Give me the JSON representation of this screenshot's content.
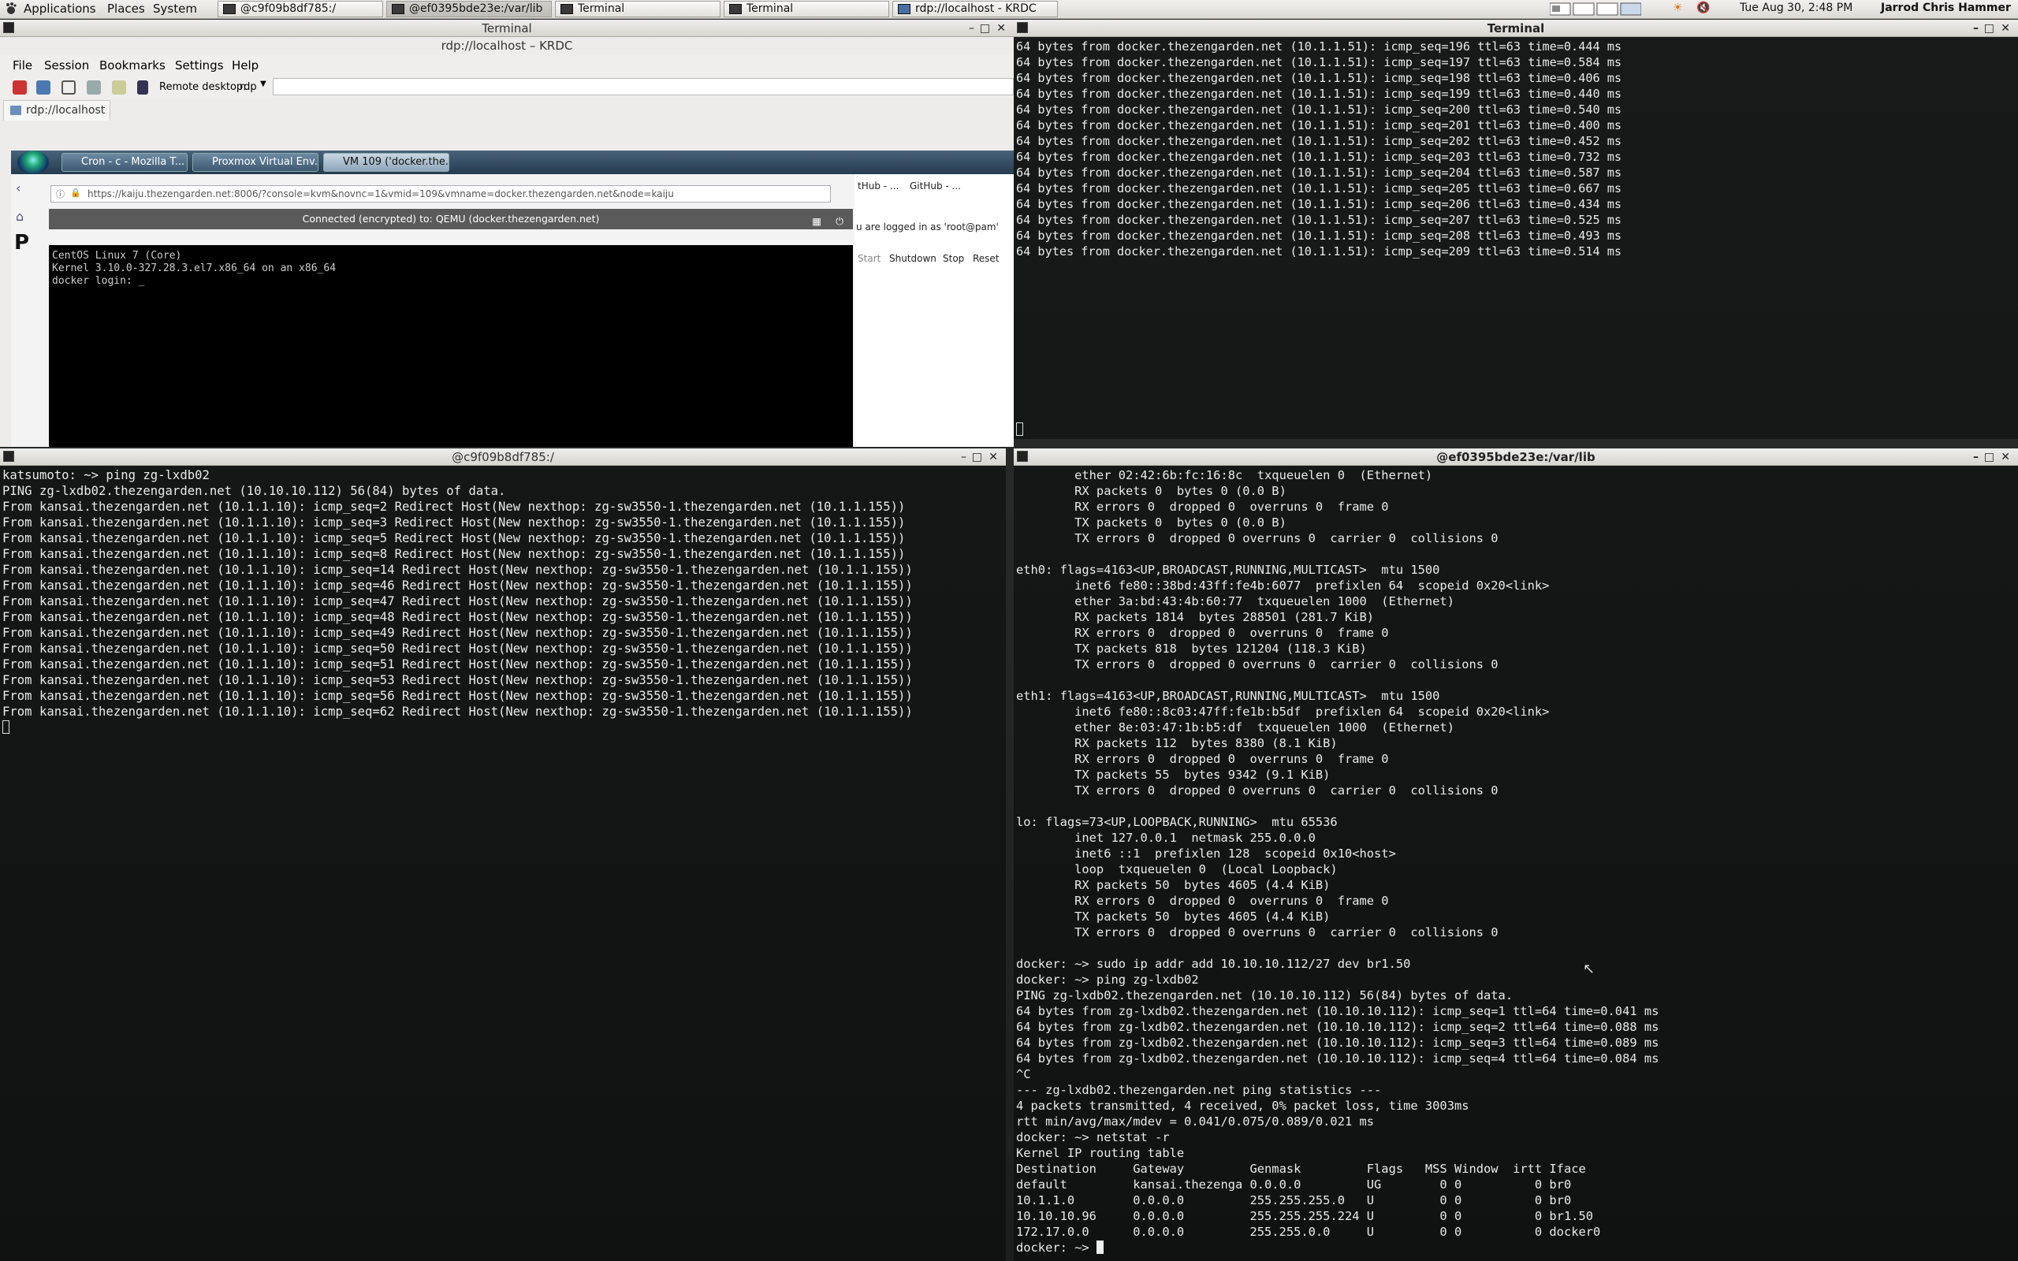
{
  "panel": {
    "menus": [
      "Applications",
      "Places",
      "System"
    ],
    "tasks": [
      {
        "label": "@c9f09b8df785:/",
        "active": false
      },
      {
        "label": "@ef0395bde23e:/var/lib",
        "active": true
      },
      {
        "label": "Terminal",
        "active": false
      },
      {
        "label": "Terminal",
        "active": false
      },
      {
        "label": "rdp://localhost - KRDC",
        "active": false
      }
    ],
    "clock": "Tue Aug 30,  2:48 PM",
    "user": "Jarrod Chris Hammer"
  },
  "krdc": {
    "window_title": "Terminal",
    "title": "rdp://localhost – KRDC",
    "menu": [
      "File",
      "Session",
      "Bookmarks",
      "Settings",
      "Help"
    ],
    "remote_desktop_label": "Remote desktop:",
    "protocol": "rdp",
    "tab": "rdp://localhost",
    "win7_tabs": [
      "Cron - c - Mozilla T...",
      "Proxmox Virtual Env...",
      "VM 109 ('docker.the..."
    ],
    "url": "https://kaiju.thezengarden.net:8006/?console=kvm&novnc=1&vmid=109&vmname=docker.thezengarden.net&node=kaiju",
    "novnc_status": "Connected (encrypted) to: QEMU (docker.thezengarden.net)",
    "console_lines": [
      "CentOS Linux 7 (Core)",
      "Kernel 3.10.0-327.28.3.el7.x86_64 on an x86_64",
      "",
      "docker login: _"
    ],
    "proxmox_tabs": [
      "tHub - ...",
      "GitHub - ..."
    ],
    "proxmox_login": "u are logged in as 'root@pam'",
    "proxmox_actions": [
      "Start",
      "Shutdown",
      "Stop",
      "Reset"
    ]
  },
  "term_top_right": {
    "title": "Terminal",
    "lines": [
      "64 bytes from docker.thezengarden.net (10.1.1.51): icmp_seq=196 ttl=63 time=0.444 ms",
      "64 bytes from docker.thezengarden.net (10.1.1.51): icmp_seq=197 ttl=63 time=0.584 ms",
      "64 bytes from docker.thezengarden.net (10.1.1.51): icmp_seq=198 ttl=63 time=0.406 ms",
      "64 bytes from docker.thezengarden.net (10.1.1.51): icmp_seq=199 ttl=63 time=0.440 ms",
      "64 bytes from docker.thezengarden.net (10.1.1.51): icmp_seq=200 ttl=63 time=0.540 ms",
      "64 bytes from docker.thezengarden.net (10.1.1.51): icmp_seq=201 ttl=63 time=0.400 ms",
      "64 bytes from docker.thezengarden.net (10.1.1.51): icmp_seq=202 ttl=63 time=0.452 ms",
      "64 bytes from docker.thezengarden.net (10.1.1.51): icmp_seq=203 ttl=63 time=0.732 ms",
      "64 bytes from docker.thezengarden.net (10.1.1.51): icmp_seq=204 ttl=63 time=0.587 ms",
      "64 bytes from docker.thezengarden.net (10.1.1.51): icmp_seq=205 ttl=63 time=0.667 ms",
      "64 bytes from docker.thezengarden.net (10.1.1.51): icmp_seq=206 ttl=63 time=0.434 ms",
      "64 bytes from docker.thezengarden.net (10.1.1.51): icmp_seq=207 ttl=63 time=0.525 ms",
      "64 bytes from docker.thezengarden.net (10.1.1.51): icmp_seq=208 ttl=63 time=0.493 ms",
      "64 bytes from docker.thezengarden.net (10.1.1.51): icmp_seq=209 ttl=63 time=0.514 ms"
    ]
  },
  "term_bottom_left": {
    "title": "@c9f09b8df785:/",
    "lines": [
      "katsumoto: ~> ping zg-lxdb02",
      "PING zg-lxdb02.thezengarden.net (10.10.10.112) 56(84) bytes of data.",
      "From kansai.thezengarden.net (10.1.1.10): icmp_seq=2 Redirect Host(New nexthop: zg-sw3550-1.thezengarden.net (10.1.1.155))",
      "From kansai.thezengarden.net (10.1.1.10): icmp_seq=3 Redirect Host(New nexthop: zg-sw3550-1.thezengarden.net (10.1.1.155))",
      "From kansai.thezengarden.net (10.1.1.10): icmp_seq=5 Redirect Host(New nexthop: zg-sw3550-1.thezengarden.net (10.1.1.155))",
      "From kansai.thezengarden.net (10.1.1.10): icmp_seq=8 Redirect Host(New nexthop: zg-sw3550-1.thezengarden.net (10.1.1.155))",
      "From kansai.thezengarden.net (10.1.1.10): icmp_seq=14 Redirect Host(New nexthop: zg-sw3550-1.thezengarden.net (10.1.1.155))",
      "From kansai.thezengarden.net (10.1.1.10): icmp_seq=46 Redirect Host(New nexthop: zg-sw3550-1.thezengarden.net (10.1.1.155))",
      "From kansai.thezengarden.net (10.1.1.10): icmp_seq=47 Redirect Host(New nexthop: zg-sw3550-1.thezengarden.net (10.1.1.155))",
      "From kansai.thezengarden.net (10.1.1.10): icmp_seq=48 Redirect Host(New nexthop: zg-sw3550-1.thezengarden.net (10.1.1.155))",
      "From kansai.thezengarden.net (10.1.1.10): icmp_seq=49 Redirect Host(New nexthop: zg-sw3550-1.thezengarden.net (10.1.1.155))",
      "From kansai.thezengarden.net (10.1.1.10): icmp_seq=50 Redirect Host(New nexthop: zg-sw3550-1.thezengarden.net (10.1.1.155))",
      "From kansai.thezengarden.net (10.1.1.10): icmp_seq=51 Redirect Host(New nexthop: zg-sw3550-1.thezengarden.net (10.1.1.155))",
      "From kansai.thezengarden.net (10.1.1.10): icmp_seq=53 Redirect Host(New nexthop: zg-sw3550-1.thezengarden.net (10.1.1.155))",
      "From kansai.thezengarden.net (10.1.1.10): icmp_seq=56 Redirect Host(New nexthop: zg-sw3550-1.thezengarden.net (10.1.1.155))",
      "From kansai.thezengarden.net (10.1.1.10): icmp_seq=62 Redirect Host(New nexthop: zg-sw3550-1.thezengarden.net (10.1.1.155))"
    ]
  },
  "term_bottom_right": {
    "title": "@ef0395bde23e:/var/lib",
    "lines": [
      "        ether 02:42:6b:fc:16:8c  txqueuelen 0  (Ethernet)",
      "        RX packets 0  bytes 0 (0.0 B)",
      "        RX errors 0  dropped 0  overruns 0  frame 0",
      "        TX packets 0  bytes 0 (0.0 B)",
      "        TX errors 0  dropped 0 overruns 0  carrier 0  collisions 0",
      "",
      "eth0: flags=4163<UP,BROADCAST,RUNNING,MULTICAST>  mtu 1500",
      "        inet6 fe80::38bd:43ff:fe4b:6077  prefixlen 64  scopeid 0x20<link>",
      "        ether 3a:bd:43:4b:60:77  txqueuelen 1000  (Ethernet)",
      "        RX packets 1814  bytes 288501 (281.7 KiB)",
      "        RX errors 0  dropped 0  overruns 0  frame 0",
      "        TX packets 818  bytes 121204 (118.3 KiB)",
      "        TX errors 0  dropped 0 overruns 0  carrier 0  collisions 0",
      "",
      "eth1: flags=4163<UP,BROADCAST,RUNNING,MULTICAST>  mtu 1500",
      "        inet6 fe80::8c03:47ff:fe1b:b5df  prefixlen 64  scopeid 0x20<link>",
      "        ether 8e:03:47:1b:b5:df  txqueuelen 1000  (Ethernet)",
      "        RX packets 112  bytes 8380 (8.1 KiB)",
      "        RX errors 0  dropped 0  overruns 0  frame 0",
      "        TX packets 55  bytes 9342 (9.1 KiB)",
      "        TX errors 0  dropped 0 overruns 0  carrier 0  collisions 0",
      "",
      "lo: flags=73<UP,LOOPBACK,RUNNING>  mtu 65536",
      "        inet 127.0.0.1  netmask 255.0.0.0",
      "        inet6 ::1  prefixlen 128  scopeid 0x10<host>",
      "        loop  txqueuelen 0  (Local Loopback)",
      "        RX packets 50  bytes 4605 (4.4 KiB)",
      "        RX errors 0  dropped 0  overruns 0  frame 0",
      "        TX packets 50  bytes 4605 (4.4 KiB)",
      "        TX errors 0  dropped 0 overruns 0  carrier 0  collisions 0",
      "",
      "docker: ~> sudo ip addr add 10.10.10.112/27 dev br1.50",
      "docker: ~> ping zg-lxdb02",
      "PING zg-lxdb02.thezengarden.net (10.10.10.112) 56(84) bytes of data.",
      "64 bytes from zg-lxdb02.thezengarden.net (10.10.10.112): icmp_seq=1 ttl=64 time=0.041 ms",
      "64 bytes from zg-lxdb02.thezengarden.net (10.10.10.112): icmp_seq=2 ttl=64 time=0.088 ms",
      "64 bytes from zg-lxdb02.thezengarden.net (10.10.10.112): icmp_seq=3 ttl=64 time=0.089 ms",
      "64 bytes from zg-lxdb02.thezengarden.net (10.10.10.112): icmp_seq=4 ttl=64 time=0.084 ms",
      "^C",
      "--- zg-lxdb02.thezengarden.net ping statistics ---",
      "4 packets transmitted, 4 received, 0% packet loss, time 3003ms",
      "rtt min/avg/max/mdev = 0.041/0.075/0.089/0.021 ms",
      "docker: ~> netstat -r",
      "Kernel IP routing table",
      "Destination     Gateway         Genmask         Flags   MSS Window  irtt Iface",
      "default         kansai.thezenga 0.0.0.0         UG        0 0          0 br0",
      "10.1.1.0        0.0.0.0         255.255.255.0   U         0 0          0 br0",
      "10.10.10.96     0.0.0.0         255.255.255.224 U         0 0          0 br1.50",
      "172.17.0.0      0.0.0.0         255.255.0.0     U         0 0          0 docker0"
    ],
    "prompt": "docker: ~> "
  }
}
